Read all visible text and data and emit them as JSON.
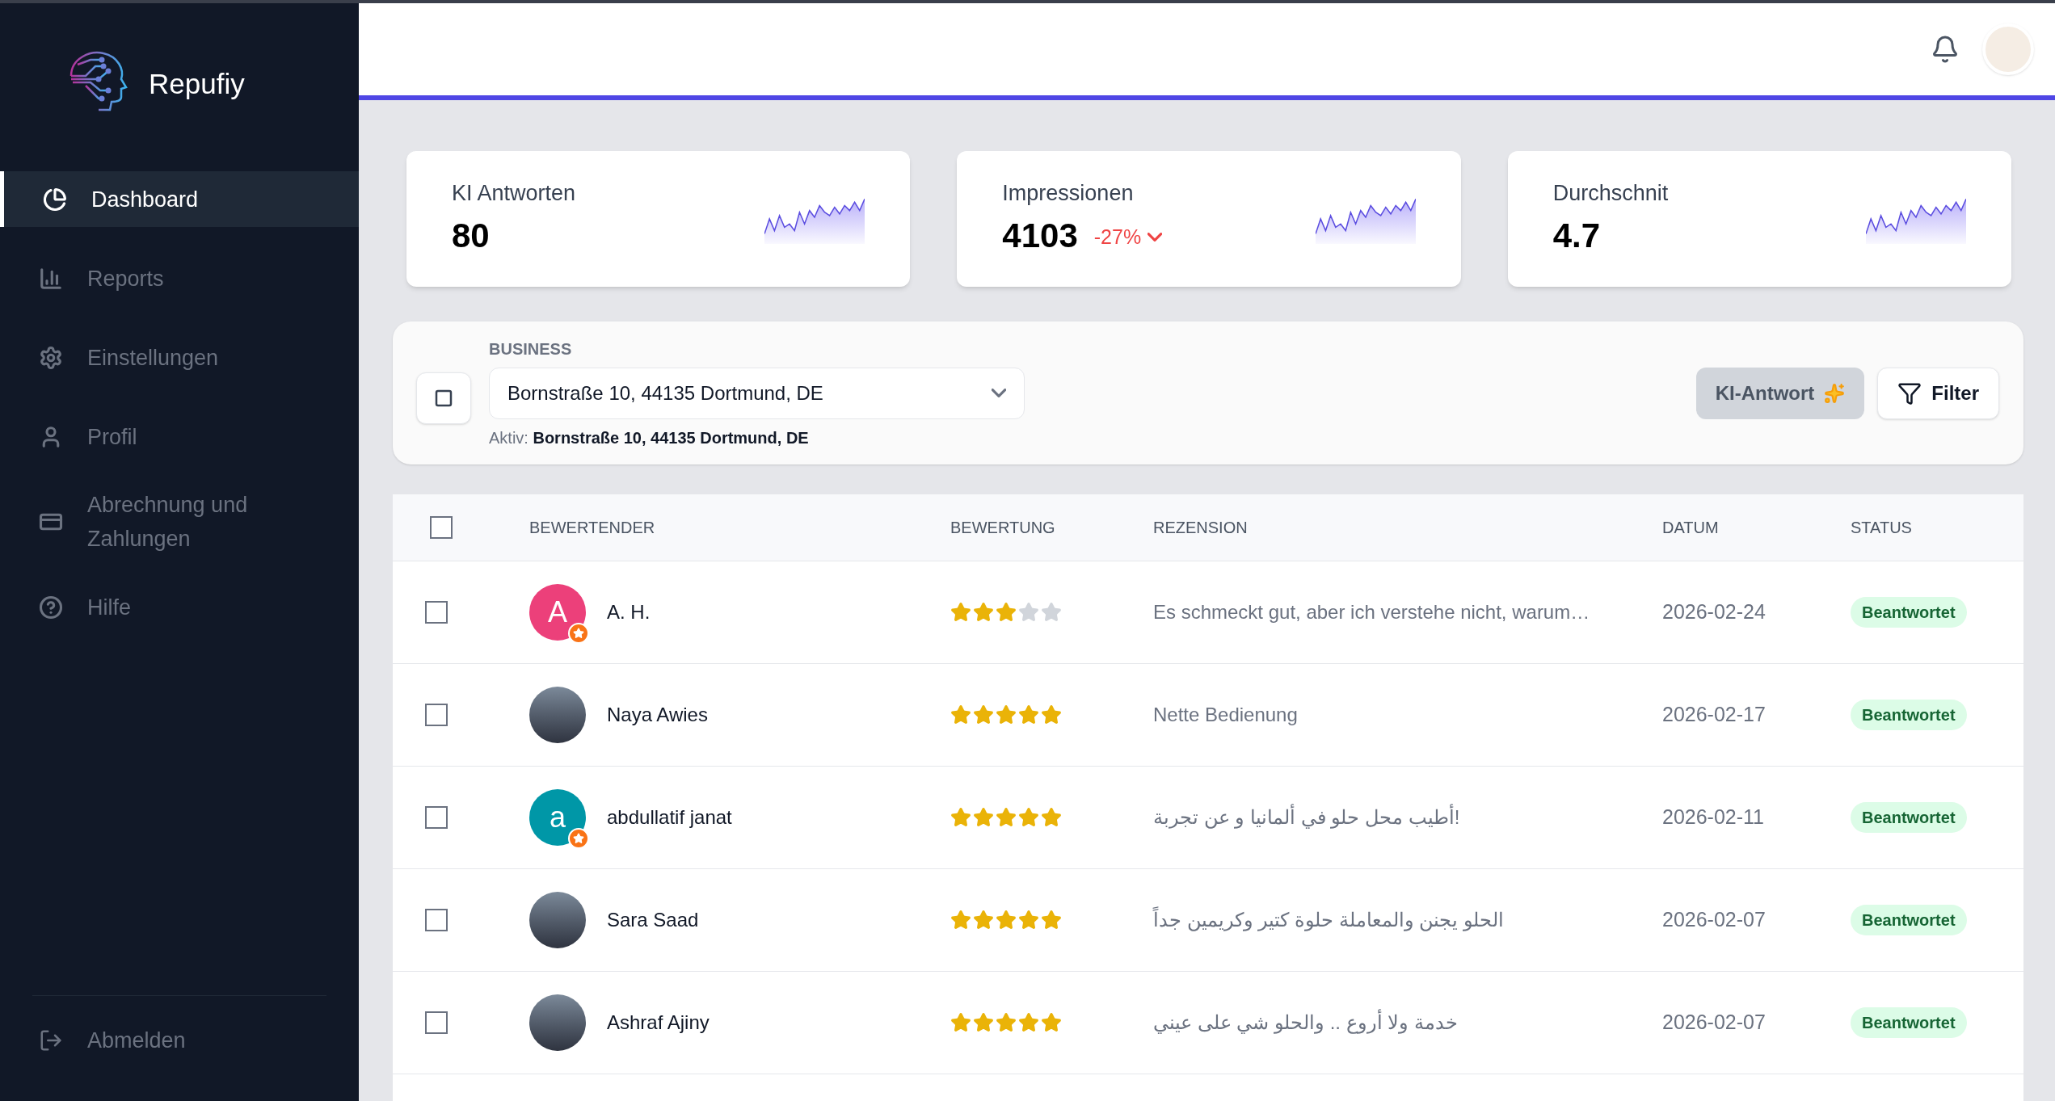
{
  "brand": {
    "name": "Repufiy"
  },
  "sidebar": {
    "items": [
      {
        "label": "Dashboard",
        "selected": true
      },
      {
        "label": "Reports",
        "selected": false
      },
      {
        "label": "Einstellungen",
        "selected": false
      },
      {
        "label": "Profil",
        "selected": false
      },
      {
        "label": "Abrechnung und Zahlungen",
        "selected": false
      },
      {
        "label": "Hilfe",
        "selected": false
      }
    ],
    "logout": "Abmelden"
  },
  "stats": [
    {
      "title": "KI Antworten",
      "value": "80"
    },
    {
      "title": "Impressionen",
      "value": "4103",
      "change": "-27%",
      "negative": true
    },
    {
      "title": "Durchschnit",
      "value": "4.7"
    }
  ],
  "business": {
    "label": "BUSINESS",
    "value": "Bornstraße 10, 44135 Dortmund, DE",
    "active": "Aktiv: **Bornstraße 10, 44135 Dortmund, DE**"
  },
  "actions": [
    {
      "label": "KI-Antwort",
      "disabled": true
    },
    {
      "label": "Filter",
      "disabled": false
    }
  ],
  "table": {
    "select_all": {
      "checked": false
    },
    "columns": [
      "BEWERTENDER",
      "BEWERTUNG",
      "REZENSION",
      "DATUM",
      "STATUS"
    ],
    "rows": [
      {
        "checked": false,
        "avatar": {
          "kind": "letter",
          "letter": "A",
          "color": "#ec407a"
        },
        "name": "A. H.",
        "stars": 3,
        "review": "Es schmeckt gut, aber ich verstehe nicht, warum…",
        "date": "2026-02-24",
        "status": "Beantwortet"
      },
      {
        "checked": false,
        "avatar": {
          "kind": "photo"
        },
        "name": "Naya Awies",
        "stars": 5,
        "review": "Nette Bedienung",
        "date": "2026-02-17",
        "status": "Beantwortet"
      },
      {
        "checked": false,
        "avatar": {
          "kind": "letter",
          "letter": "a",
          "color": "#0097a7"
        },
        "name": "abdullatif janat",
        "stars": 5,
        "review": "أطيب محل حلو في ألمانيا و عن تجربة!",
        "date": "2026-02-11",
        "status": "Beantwortet"
      },
      {
        "checked": false,
        "avatar": {
          "kind": "photo"
        },
        "name": "Sara Saad",
        "stars": 5,
        "review": "الحلو يجنن والمعاملة حلوة كتير وكريمين جداً",
        "date": "2026-02-07",
        "status": "Beantwortet"
      },
      {
        "checked": false,
        "avatar": {
          "kind": "photo"
        },
        "name": "Ashraf Ajiny",
        "stars": 5,
        "review": "خدمة ولا أروع .. والحلو شي على عيني",
        "date": "2026-02-07",
        "status": "Beantwortet"
      }
    ]
  }
}
